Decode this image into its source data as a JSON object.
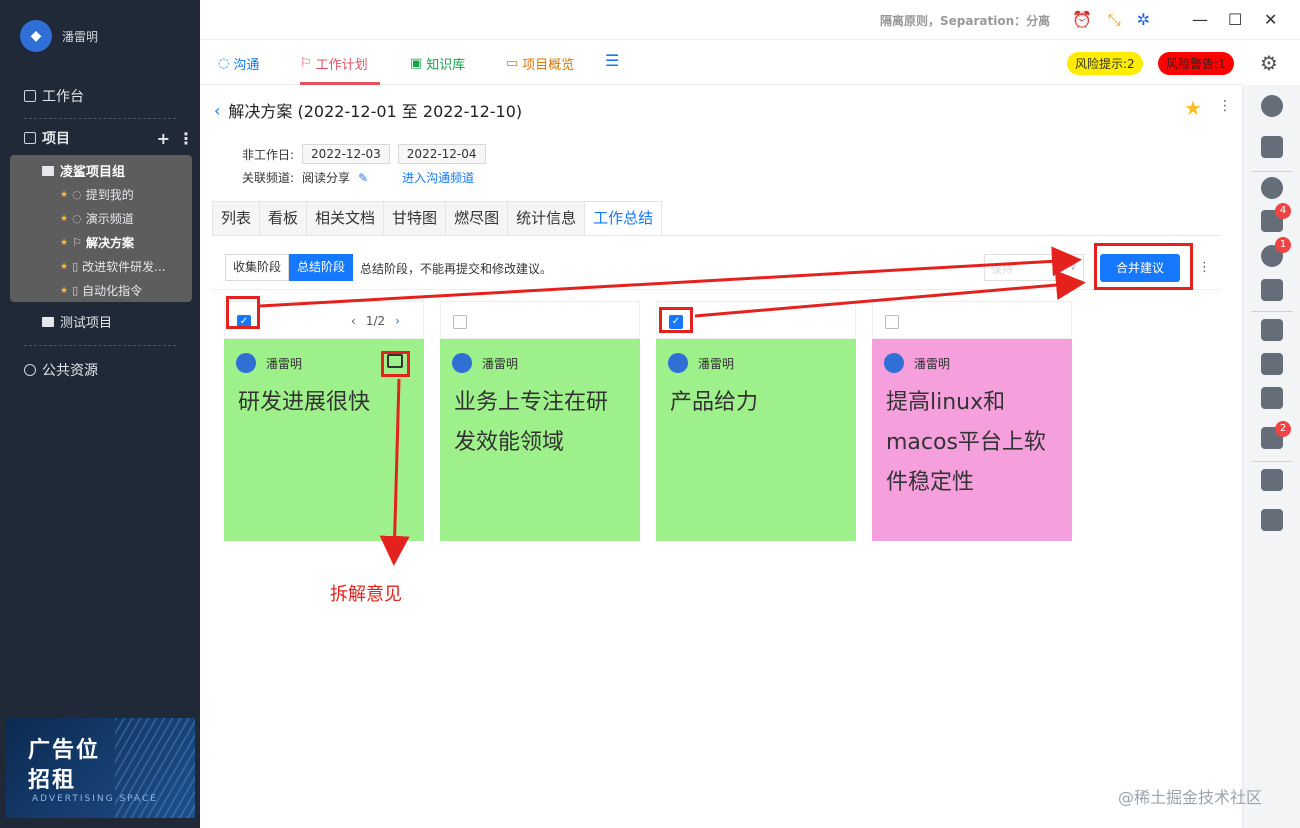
{
  "user": {
    "name": "潘雷明"
  },
  "sidebar": {
    "workbench": "工作台",
    "projects": "项目",
    "group": "凌鲨项目组",
    "items": [
      {
        "label": "提到我的"
      },
      {
        "label": "演示频道"
      },
      {
        "label": "解决方案"
      },
      {
        "label": "改进软件研发..."
      },
      {
        "label": "自动化指令"
      }
    ],
    "test_project": "测试项目",
    "public_resources": "公共资源",
    "ad": {
      "line1": "广告位",
      "line2": "招租",
      "line3": "ADVERTISING SPACE"
    }
  },
  "titlebar": {
    "text": "隔离原则，Separation：分离"
  },
  "mainnav": {
    "tabs": [
      {
        "label": "沟通"
      },
      {
        "label": "工作计划"
      },
      {
        "label": "知识库"
      },
      {
        "label": "项目概览"
      }
    ],
    "risk_hint": "风险提示:2",
    "risk_warning": "风险警告:1"
  },
  "rail": {
    "badge1": "4",
    "badge2": "1",
    "badge3": "2"
  },
  "page": {
    "title": "解决方案 (2022-12-01 至 2022-12-10)",
    "non_workday_label": "非工作日:",
    "dates": [
      "2022-12-03",
      "2022-12-04"
    ],
    "channel_label": "关联频道:",
    "channel_value": "阅读分享",
    "enter_channel": "进入沟通频道",
    "tabs": [
      "列表",
      "看板",
      "相关文档",
      "甘特图",
      "燃尽图",
      "统计信息",
      "工作总结"
    ],
    "phases": [
      "收集阶段",
      "总结阶段"
    ],
    "phase_note": "总结阶段，不能再提交和修改建议。",
    "select_placeholder": "保持",
    "merge_button": "合并建议"
  },
  "cards": [
    {
      "author": "潘雷明",
      "text": "研发进展很快",
      "checked": true,
      "pager": "1/2",
      "color": "#9ef08a"
    },
    {
      "author": "潘雷明",
      "text": "业务上专注在研发效能领域",
      "checked": false,
      "color": "#9ef08a"
    },
    {
      "author": "潘雷明",
      "text": "产品给力",
      "checked": true,
      "color": "#9ef08a"
    },
    {
      "author": "潘雷明",
      "text": "提高linux和macos平台上软件稳定性",
      "checked": false,
      "color": "#f59fdc"
    }
  ],
  "annotation": {
    "label": "拆解意见"
  },
  "watermark": "@稀土掘金技术社区"
}
